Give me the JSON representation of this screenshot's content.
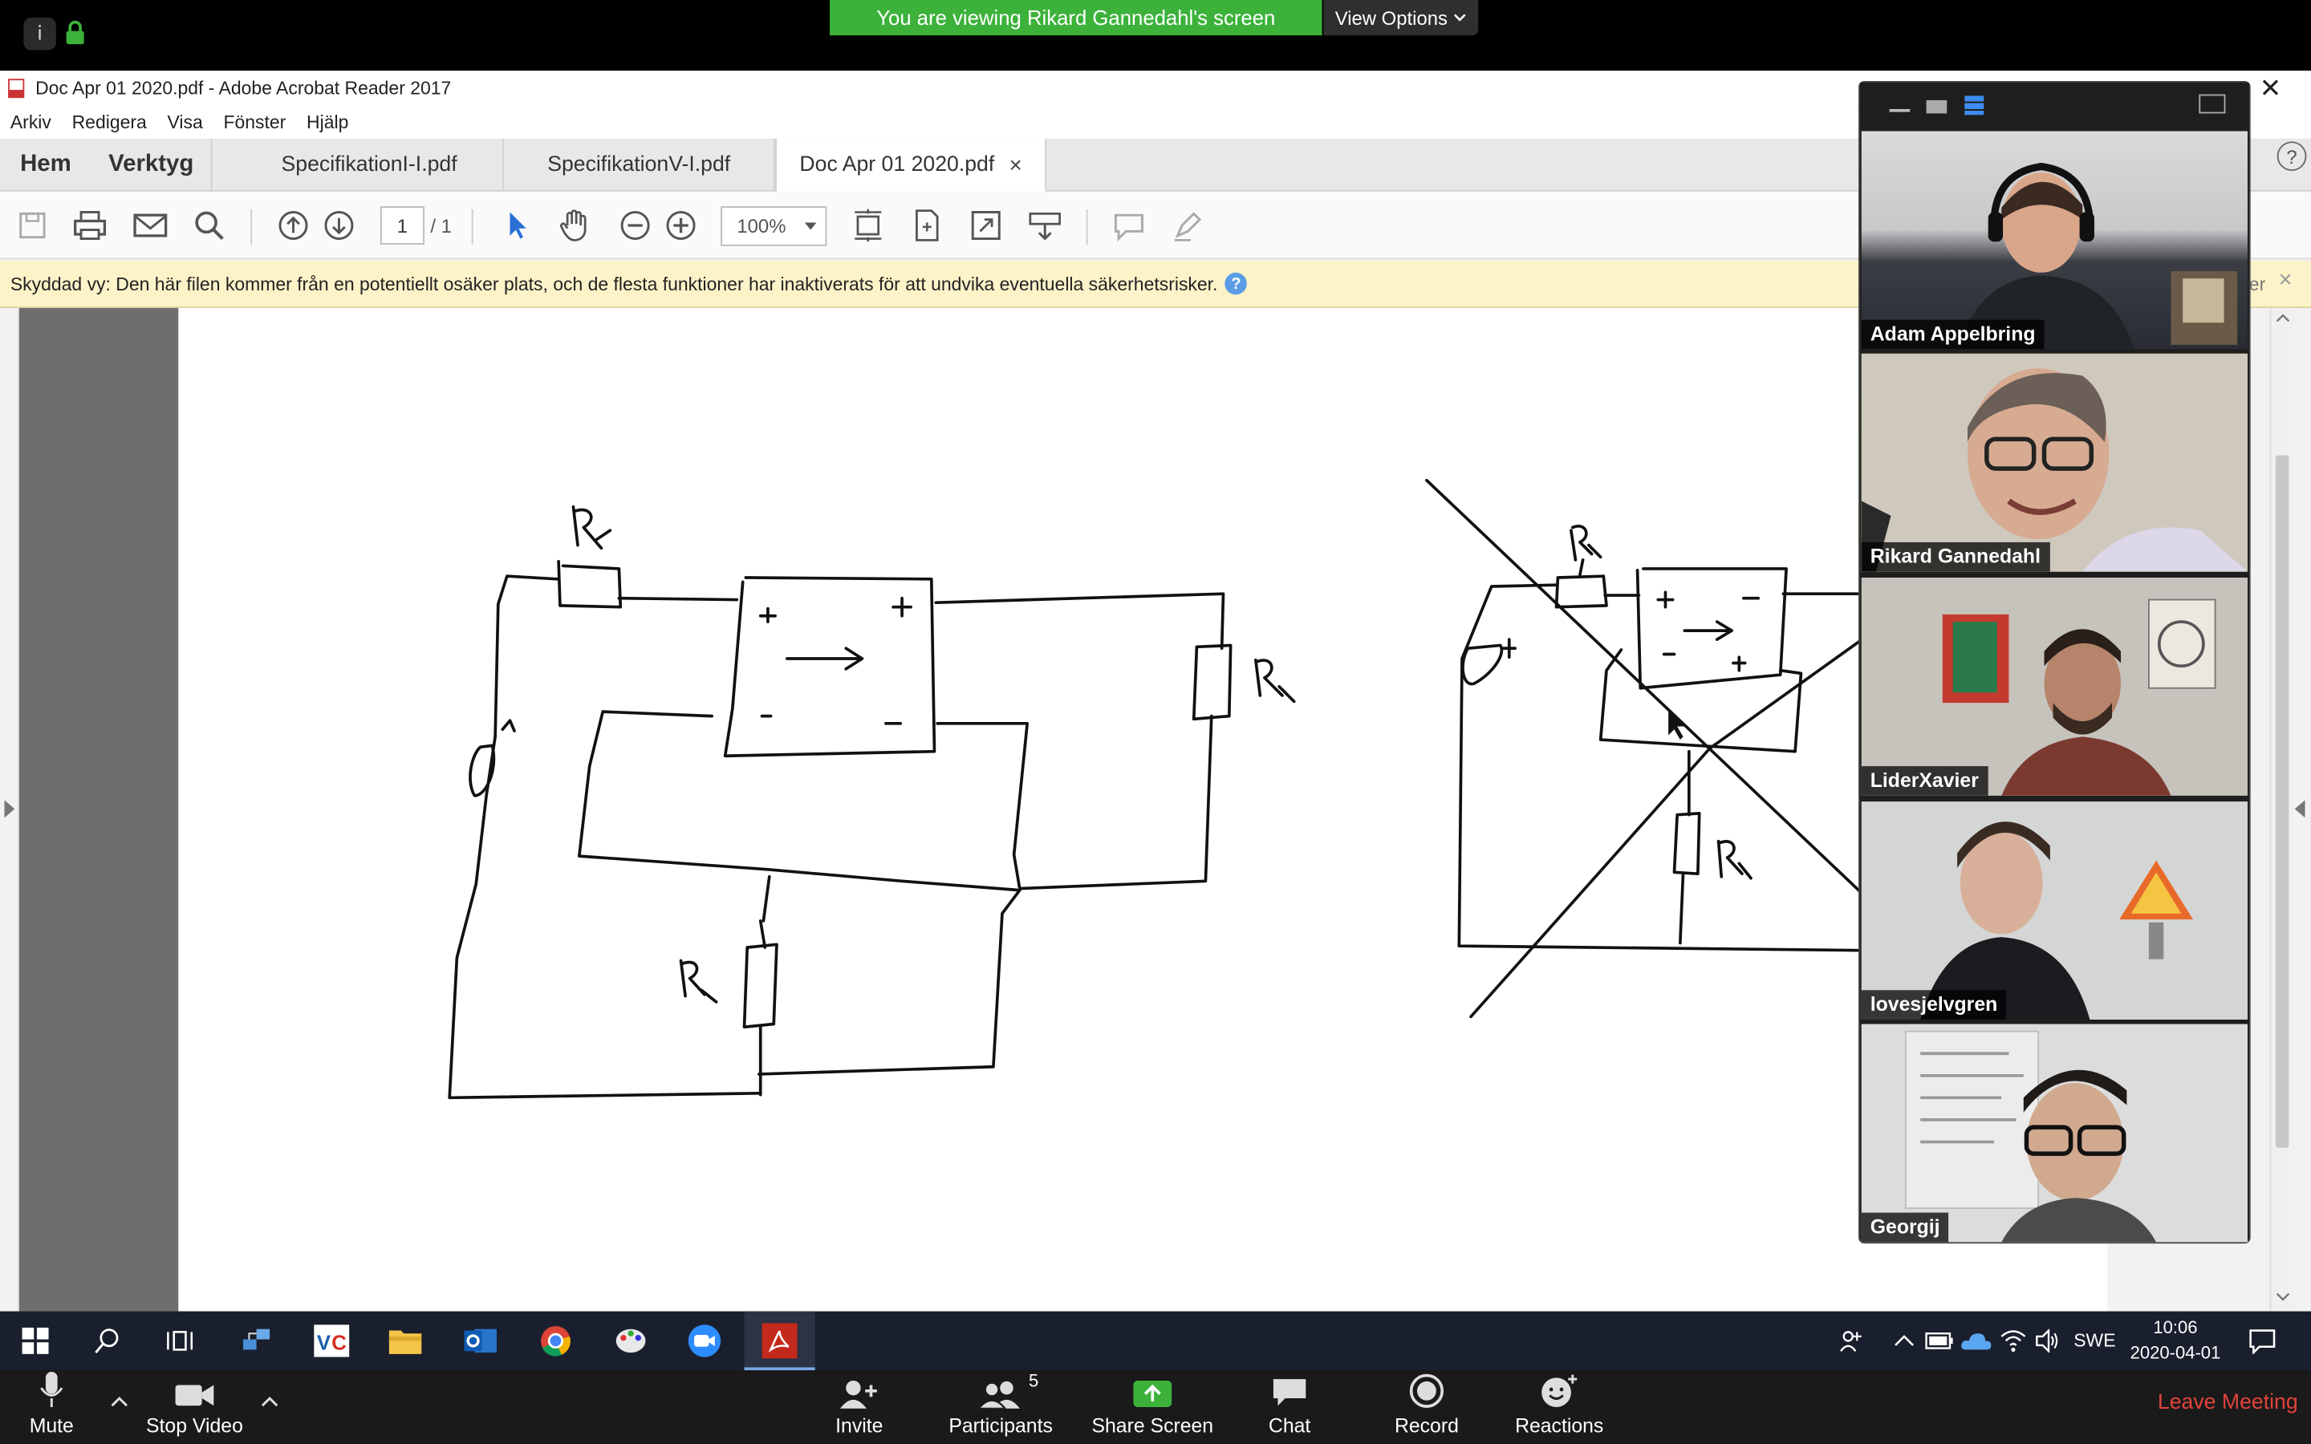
{
  "zoom_top": {
    "banner": "You are viewing Rikard Gannedahl's screen",
    "view_options": "View Options"
  },
  "acrobat": {
    "window_title": "Doc Apr 01 2020.pdf - Adobe Acrobat Reader 2017",
    "menu": [
      "Arkiv",
      "Redigera",
      "Visa",
      "Fönster",
      "Hjälp"
    ],
    "nav": {
      "home": "Hem",
      "tools": "Verktyg"
    },
    "tabs": [
      "SpecifikationI-I.pdf",
      "SpecifikationV-I.pdf",
      "Doc Apr 01 2020.pdf"
    ],
    "page_current": "1",
    "page_total": "/ 1",
    "zoom": "100%",
    "warning": "Skyddad vy: Den här filen kommer från en potentiellt osäker plats, och de flesta funktioner har inaktiverats för att undvika eventuella säkerhetsrisker.",
    "warning_tail": "er"
  },
  "participants": [
    {
      "name": "Adam Appelbring"
    },
    {
      "name": "Rikard Gannedahl"
    },
    {
      "name": "LiderXavier"
    },
    {
      "name": "lovesjelvgren"
    },
    {
      "name": "Georgij"
    }
  ],
  "taskbar": {
    "lang": "SWE",
    "time": "10:06",
    "date": "2020-04-01"
  },
  "zoom_controls": {
    "mute": "Mute",
    "stop_video": "Stop Video",
    "invite": "Invite",
    "participants": "Participants",
    "participants_count": "5",
    "share": "Share Screen",
    "chat": "Chat",
    "record": "Record",
    "reactions": "Reactions",
    "leave": "Leave Meeting"
  },
  "colors": {
    "banner_green": "#3cb23b",
    "warning_bg": "#fcf3c9",
    "active_speaker": "#b9e04a",
    "leave_red": "#e0433b"
  }
}
